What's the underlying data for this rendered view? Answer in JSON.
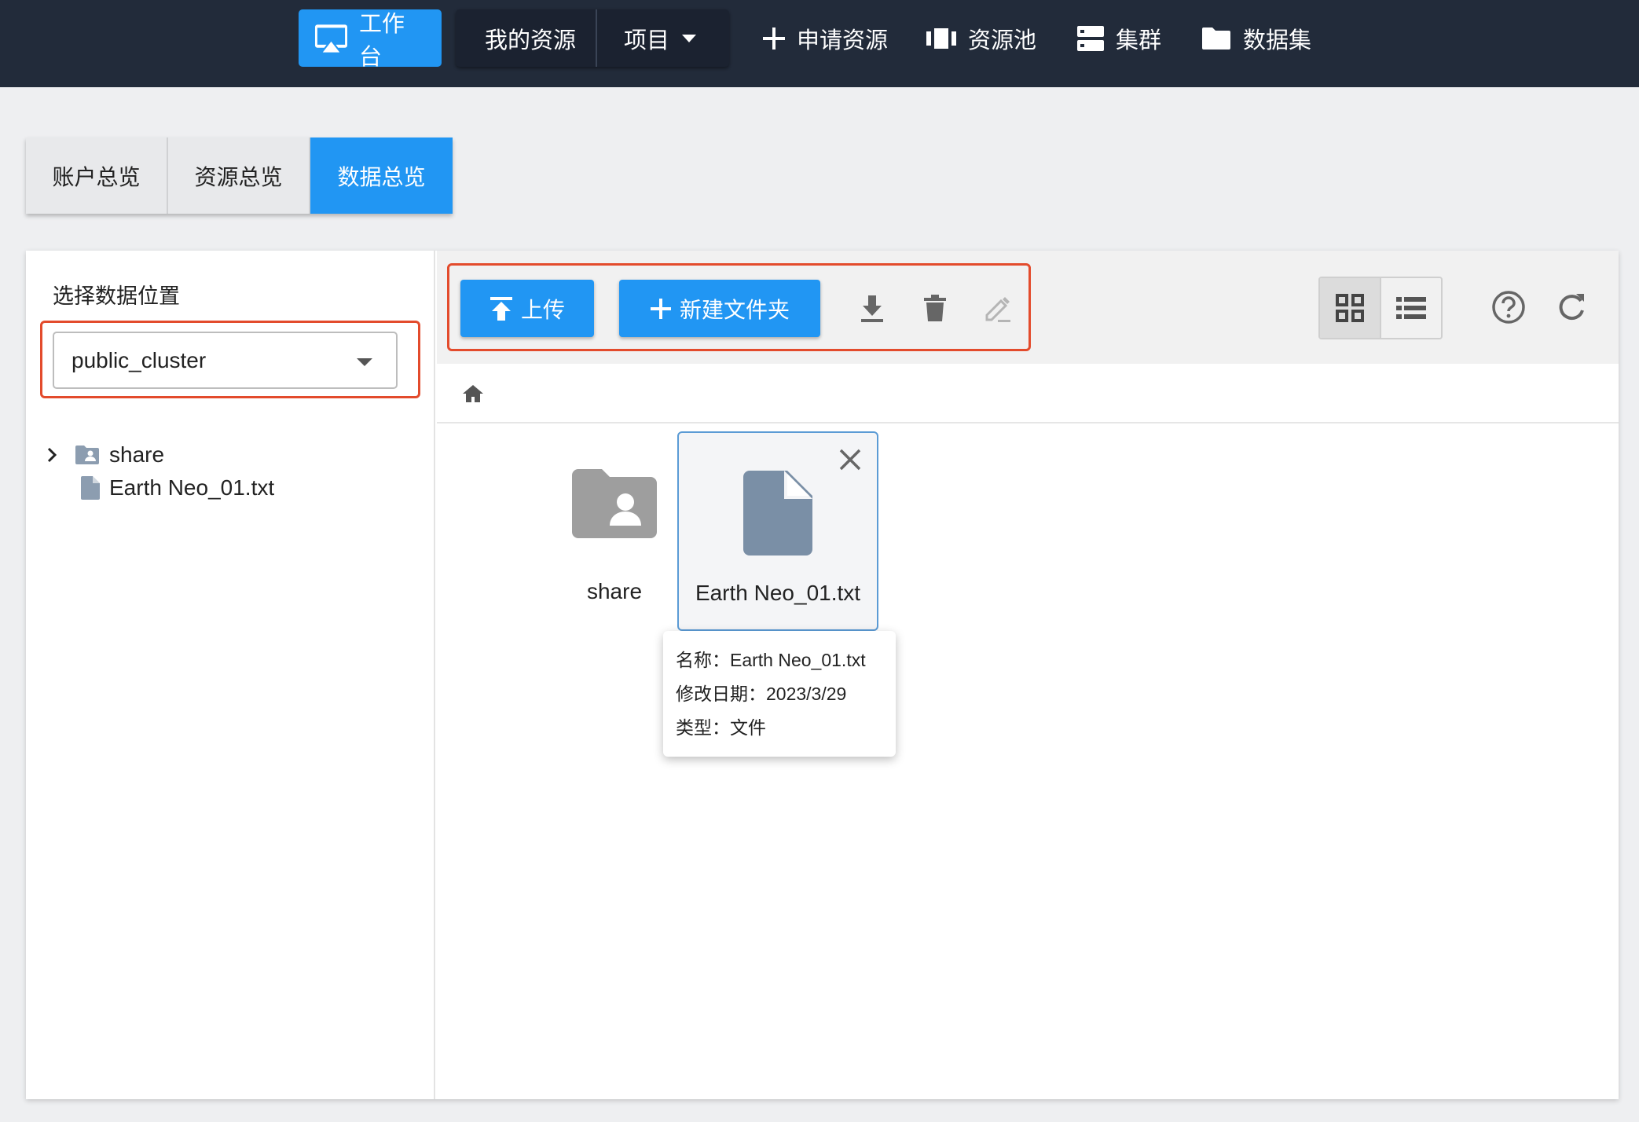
{
  "nav": {
    "workbench": "工作台",
    "my_resources": "我的资源",
    "project": "项目",
    "apply_resource": "申请资源",
    "resource_pool": "资源池",
    "cluster": "集群",
    "dataset": "数据集"
  },
  "tabs": [
    {
      "label": "账户总览",
      "active": false
    },
    {
      "label": "资源总览",
      "active": false
    },
    {
      "label": "数据总览",
      "active": true
    }
  ],
  "sidebar": {
    "title": "选择数据位置",
    "location_select": {
      "value": "public_cluster"
    },
    "tree": [
      {
        "label": "share",
        "type": "shared-folder",
        "expandable": true
      },
      {
        "label": "Earth Neo_01.txt",
        "type": "file",
        "expandable": false
      }
    ]
  },
  "toolbar": {
    "upload_label": "上传",
    "new_folder_label": "新建文件夹",
    "view_mode": "grid"
  },
  "files": [
    {
      "name": "share",
      "type": "shared-folder",
      "selected": false
    },
    {
      "name": "Earth Neo_01.txt",
      "type": "file",
      "selected": true
    }
  ],
  "tooltip": {
    "name": "名称：Earth Neo_01.txt",
    "modified": "修改日期：2023/3/29",
    "type": "类型：文件"
  },
  "colors": {
    "topbar": "#222b3a",
    "accent": "#2196f3",
    "highlight_outline": "#e34b2c",
    "file_icon": "#7a8fa6",
    "folder_icon": "#9e9e9e"
  }
}
